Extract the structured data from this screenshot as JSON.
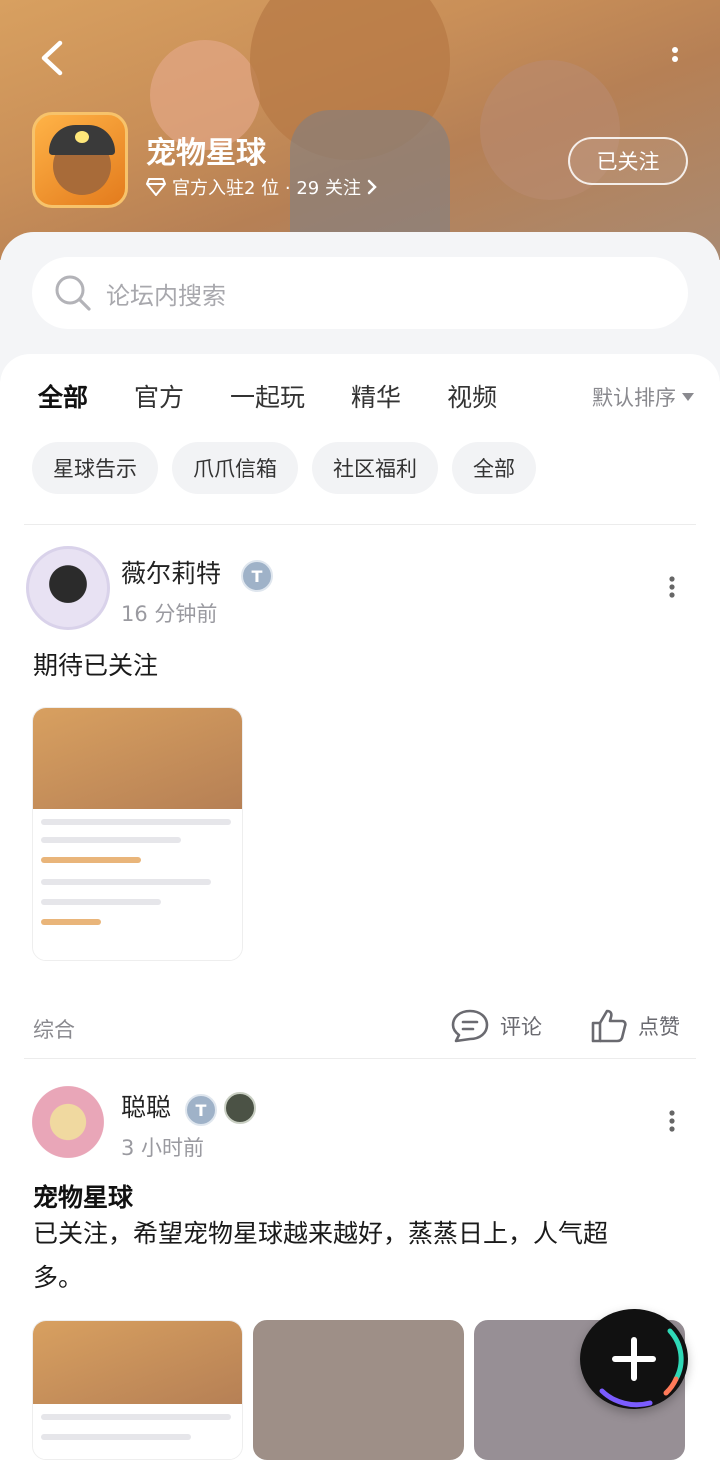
{
  "header": {
    "forum_name": "宠物星球",
    "forum_sub": "官方入驻2 位 · 29 关注",
    "follow_label": "已关注"
  },
  "search": {
    "placeholder": "论坛内搜索"
  },
  "tabs": [
    {
      "label": "全部",
      "active": true
    },
    {
      "label": "官方"
    },
    {
      "label": "一起玩"
    },
    {
      "label": "精华"
    },
    {
      "label": "视频"
    }
  ],
  "sort_label": "默认排序",
  "chips": [
    "星球告示",
    "爪爪信箱",
    "社区福利",
    "全部"
  ],
  "posts": [
    {
      "username": "薇尔莉特",
      "time": "16 分钟前",
      "text": "期待已关注",
      "category": "综合",
      "comment_label": "评论",
      "like_label": "点赞"
    },
    {
      "username": "聪聪",
      "time": "3 小时前",
      "title": "宠物星球",
      "text_line1": "已关注，希望宠物星球越来越好，蒸蒸日上，人气超",
      "text_line2": "多。"
    }
  ],
  "colors": {
    "accent": "#27c6b4",
    "banner": "#c98f58"
  }
}
